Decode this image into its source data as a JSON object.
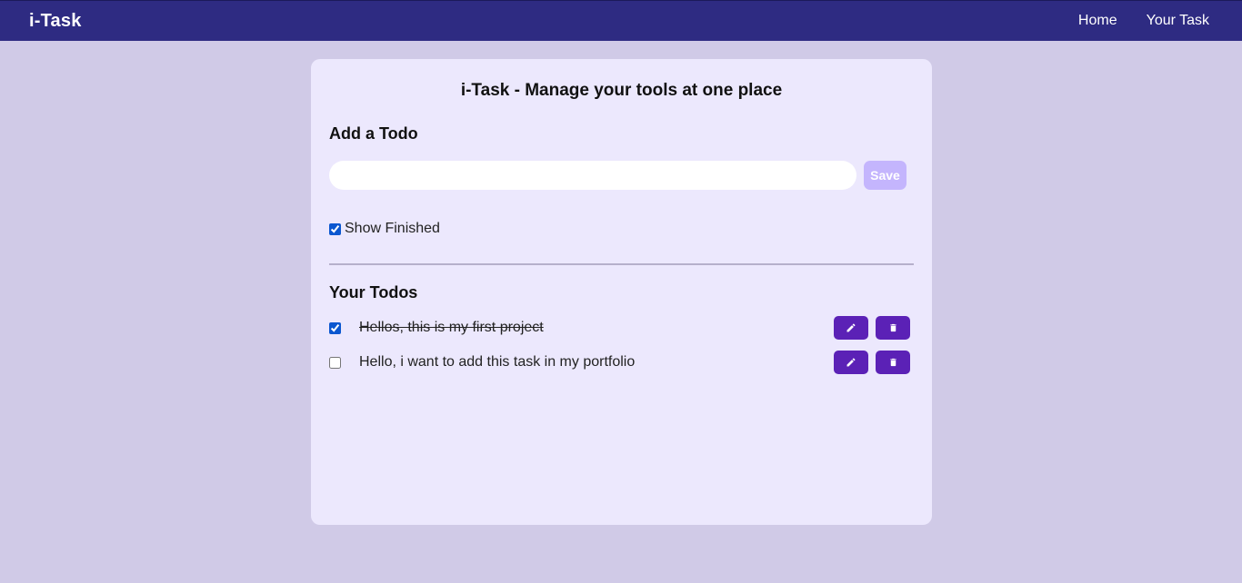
{
  "nav": {
    "brand": "i-Task",
    "links": [
      "Home",
      "Your Task"
    ]
  },
  "card": {
    "title": "i-Task - Manage your tools at one place",
    "add_heading": "Add a Todo",
    "input": {
      "value": "",
      "placeholder": ""
    },
    "save_label": "Save",
    "show_finished": {
      "label": "Show Finished",
      "checked": true
    },
    "todos_heading": "Your Todos",
    "todos": [
      {
        "text": "Hellos, this is my first project",
        "completed": true
      },
      {
        "text": "Hello, i want to add this task in my portfolio",
        "completed": false
      }
    ],
    "row_actions": {
      "edit_icon": "pencil-icon",
      "delete_icon": "trash-icon"
    }
  },
  "colors": {
    "page_bg": "#d0cae7",
    "navbar_bg": "#2e2b82",
    "card_bg": "#ece8fd",
    "accent": "#5b21b6",
    "save_disabled": "#c4b5fd"
  }
}
